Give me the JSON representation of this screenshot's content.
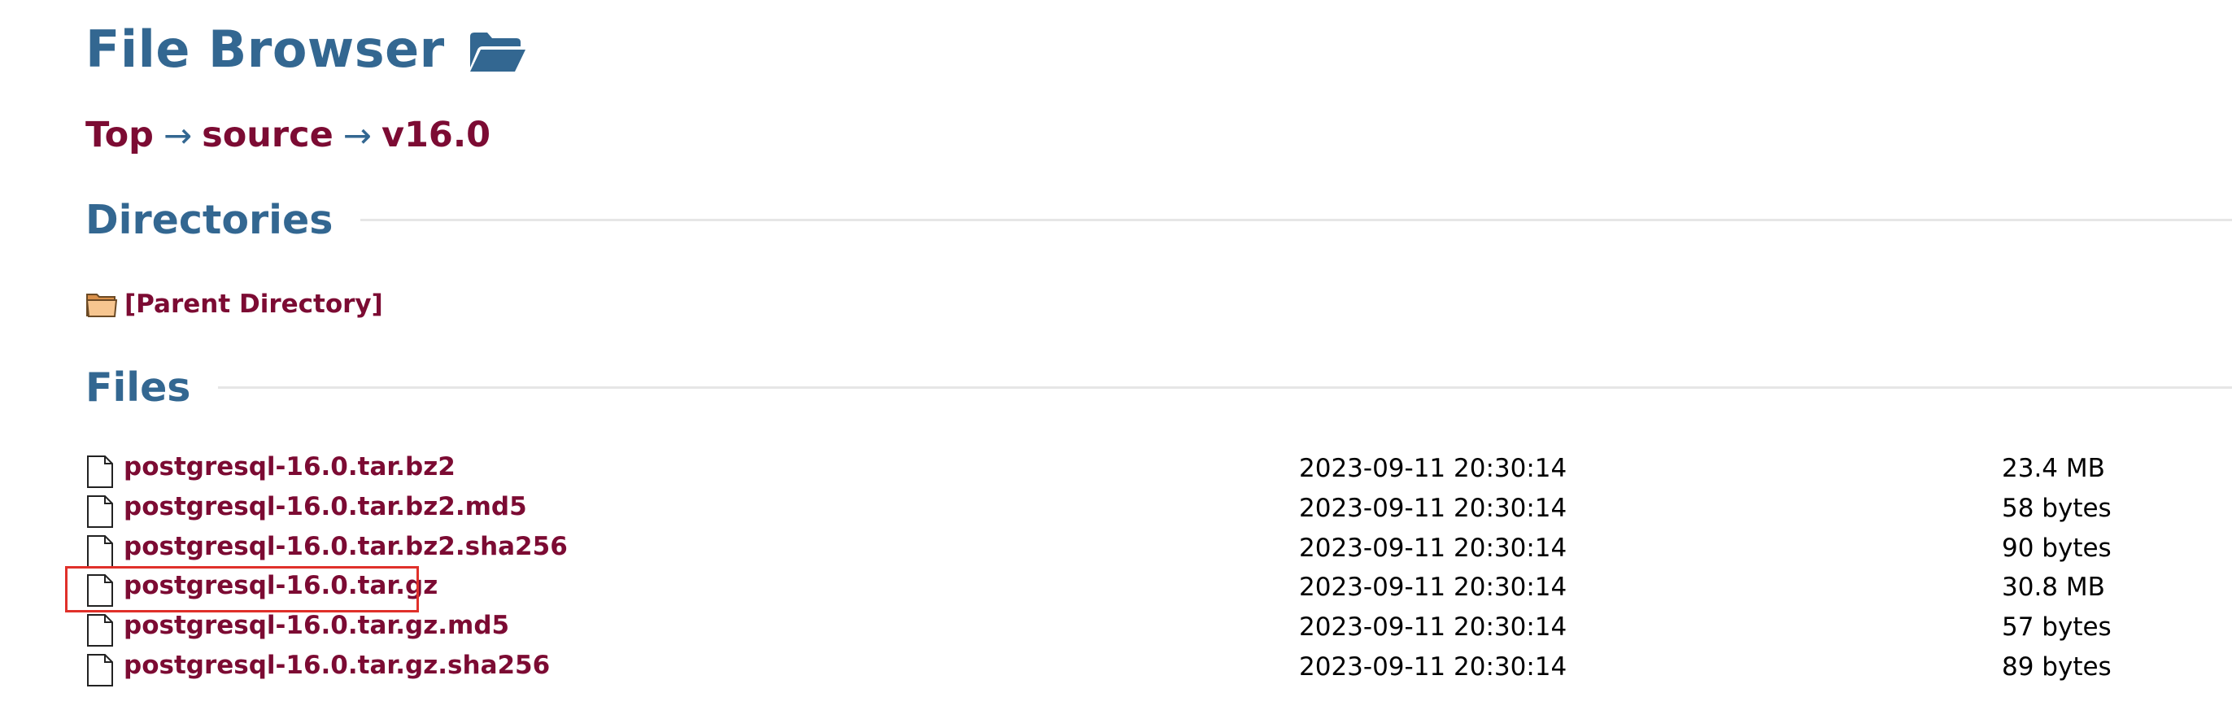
{
  "header": {
    "title": "File Browser",
    "title_icon": "folder-open-icon"
  },
  "breadcrumb": {
    "items": [
      "Top",
      "source",
      "v16.0"
    ],
    "separator": "→"
  },
  "directories": {
    "heading": "Directories",
    "items": [
      {
        "label": "[Parent Directory]",
        "icon": "folder-icon"
      }
    ]
  },
  "files": {
    "heading": "Files",
    "rows": [
      {
        "name": "postgresql-16.0.tar.bz2",
        "date": "2023-09-11 20:30:14",
        "size": "23.4 MB",
        "icon": "file-icon"
      },
      {
        "name": "postgresql-16.0.tar.bz2.md5",
        "date": "2023-09-11 20:30:14",
        "size": "58 bytes",
        "icon": "file-icon"
      },
      {
        "name": "postgresql-16.0.tar.bz2.sha256",
        "date": "2023-09-11 20:30:14",
        "size": "90 bytes",
        "icon": "file-icon"
      },
      {
        "name": "postgresql-16.0.tar.gz",
        "date": "2023-09-11 20:30:14",
        "size": "30.8 MB",
        "icon": "file-icon"
      },
      {
        "name": "postgresql-16.0.tar.gz.md5",
        "date": "2023-09-11 20:30:14",
        "size": "57 bytes",
        "icon": "file-icon"
      },
      {
        "name": "postgresql-16.0.tar.gz.sha256",
        "date": "2023-09-11 20:30:14",
        "size": "89 bytes",
        "icon": "file-icon"
      }
    ]
  },
  "colors": {
    "heading": "#336791",
    "link": "#7c0b33",
    "highlight": "#e0302a"
  }
}
